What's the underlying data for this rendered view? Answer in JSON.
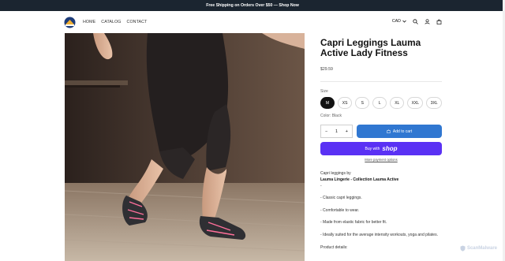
{
  "announcement": {
    "text": "Free Shipping on Orders Over $50 — Shop Now"
  },
  "header": {
    "nav": [
      "HOME",
      "CATALOG",
      "CONTACT"
    ],
    "currency": "CAD"
  },
  "product": {
    "title": "Capri Leggings Lauma Active Lady Fitness",
    "price": "$29.59",
    "size_label": "Size",
    "sizes": [
      "M",
      "XS",
      "S",
      "L",
      "XL",
      "XXL",
      "3XL"
    ],
    "selected_size": "M",
    "color_label": "Color: Black",
    "quantity": "1",
    "qty_minus": "−",
    "qty_plus": "+",
    "add_to_cart": "Add to cart",
    "buy_with": "Buy with",
    "shop_word": "shop",
    "more_payment": "More payment options"
  },
  "description": {
    "intro": "Capri leggings by",
    "brand_line": "Lauma Lingerie - Collection Lauma Active",
    "dash": "-",
    "bullets": [
      "- Classic capri leggings.",
      "- Comfortable to wear.",
      "- Made from elastic fabric for better fit.",
      "- Ideally suited for the average intensity workouts, yoga and pilates."
    ],
    "details_heading": "Product details:"
  },
  "watermark": {
    "text": "ScanMalware"
  },
  "colors": {
    "accent": "#3077d1",
    "shop_purple": "#5a31f4",
    "announce_bg": "#1b2530"
  }
}
